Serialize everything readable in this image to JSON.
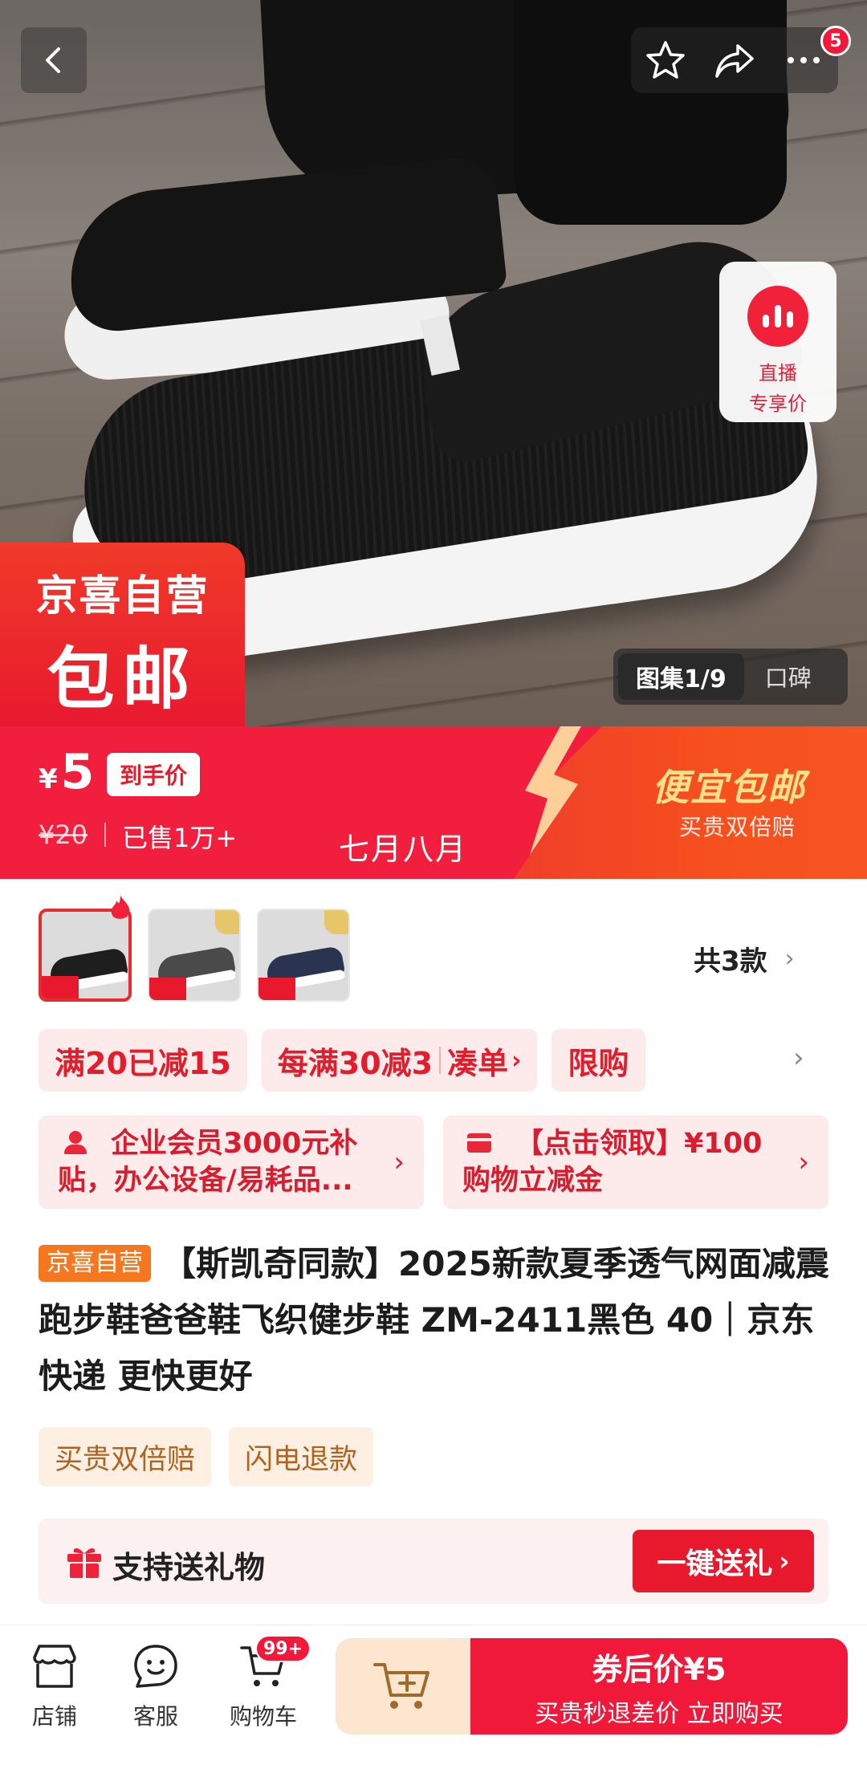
{
  "hero": {
    "live_label_line1": "直播",
    "live_label_line2": "专享价",
    "more_badge": "5",
    "promo_stamp_line1": "京喜自营",
    "promo_stamp_line2": "包邮",
    "gallery_active": "图集1/9",
    "gallery_other": "口碑"
  },
  "price": {
    "currency": "¥",
    "value": "5",
    "tag": "到手价",
    "original": "¥20",
    "sold": "已售1万+",
    "month_text": "七月八月",
    "right_title": "便宜包邮",
    "right_subtitle": "买贵双倍赔"
  },
  "variants": {
    "count_label": "共3款",
    "thumbnails": [
      "black",
      "grey",
      "navy"
    ]
  },
  "promos": {
    "chip1": "满20已减15",
    "chip2a": "每满30减3",
    "chip2b": "凑单",
    "chip3": "限购"
  },
  "cards": {
    "card1": "企业会员3000元补贴，办公设备/易耗品...",
    "card2": "【点击领取】¥100购物立减金"
  },
  "product": {
    "self_tag": "京喜自营",
    "title": "【斯凯奇同款】2025新款夏季透气网面减震跑步鞋爸爸鞋飞织健步鞋 ZM-2411黑色 40｜京东快递 更快更好"
  },
  "services": [
    "买贵双倍赔",
    "闪电退款"
  ],
  "gift": {
    "label": "支持送礼物",
    "button": "一键送礼"
  },
  "bottom": {
    "store": "店铺",
    "service": "客服",
    "cart": "购物车",
    "cart_badge": "99+",
    "buy_line1": "券后价¥5",
    "buy_line2": "买贵秒退差价 立即购买"
  },
  "colors": {
    "brand_red": "#f11f3d",
    "orange": "#f6511d",
    "gold_text": "#ffe08a"
  }
}
